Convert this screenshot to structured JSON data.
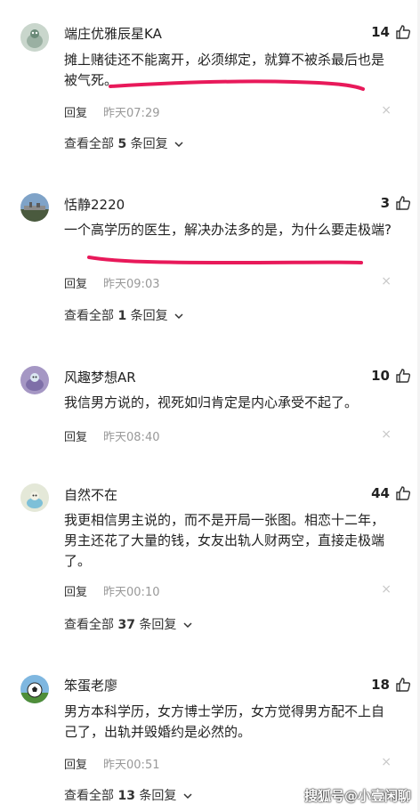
{
  "comments": [
    {
      "username": "端庄优雅辰星KA",
      "likes": "14",
      "text": "摊上赌徒还不能离开，必须绑定，就算不被杀最后也是被气死。",
      "reply_label": "回复",
      "time": "昨天07:29",
      "view_all": {
        "prefix": "查看全部 ",
        "count": "5",
        "suffix": " 条回复"
      }
    },
    {
      "username": "恬静2220",
      "likes": "3",
      "text": "一个高学历的医生，解决办法多的是，为什么要走极端?",
      "reply_label": "回复",
      "time": "昨天09:03",
      "view_all": {
        "prefix": "查看全部 ",
        "count": "1",
        "suffix": " 条回复"
      }
    },
    {
      "username": "风趣梦想AR",
      "likes": "10",
      "text": "我信男方说的，视死如归肯定是内心承受不起了。",
      "reply_label": "回复",
      "time": "昨天08:40"
    },
    {
      "username": "自然不在",
      "likes": "44",
      "text": "我更相信男主说的，而不是开局一张图。相恋十二年，男主还花了大量的钱，女友出轨人财两空，直接走极端了。",
      "reply_label": "回复",
      "time": "昨天00:10",
      "view_all": {
        "prefix": "查看全部 ",
        "count": "37",
        "suffix": " 条回复"
      }
    },
    {
      "username": "笨蛋老廖",
      "likes": "18",
      "text": "男方本科学历，女方博士学历，女方觉得男方配不上自己了，出轨并毁婚约是必然的。",
      "reply_label": "回复",
      "time": "昨天00:51",
      "view_all": {
        "prefix": "查看全部 ",
        "count": "13",
        "suffix": " 条回复"
      }
    }
  ],
  "close_glyph": "×",
  "watermark": "搜狐号@小壹闲聊",
  "colors": {
    "annotation": "#e8195a",
    "username": "#222222",
    "time": "#999999",
    "close": "#c8c8c8"
  },
  "icons": [
    "avatar",
    "thumb-up-icon",
    "chevron-down-icon",
    "close-icon"
  ]
}
